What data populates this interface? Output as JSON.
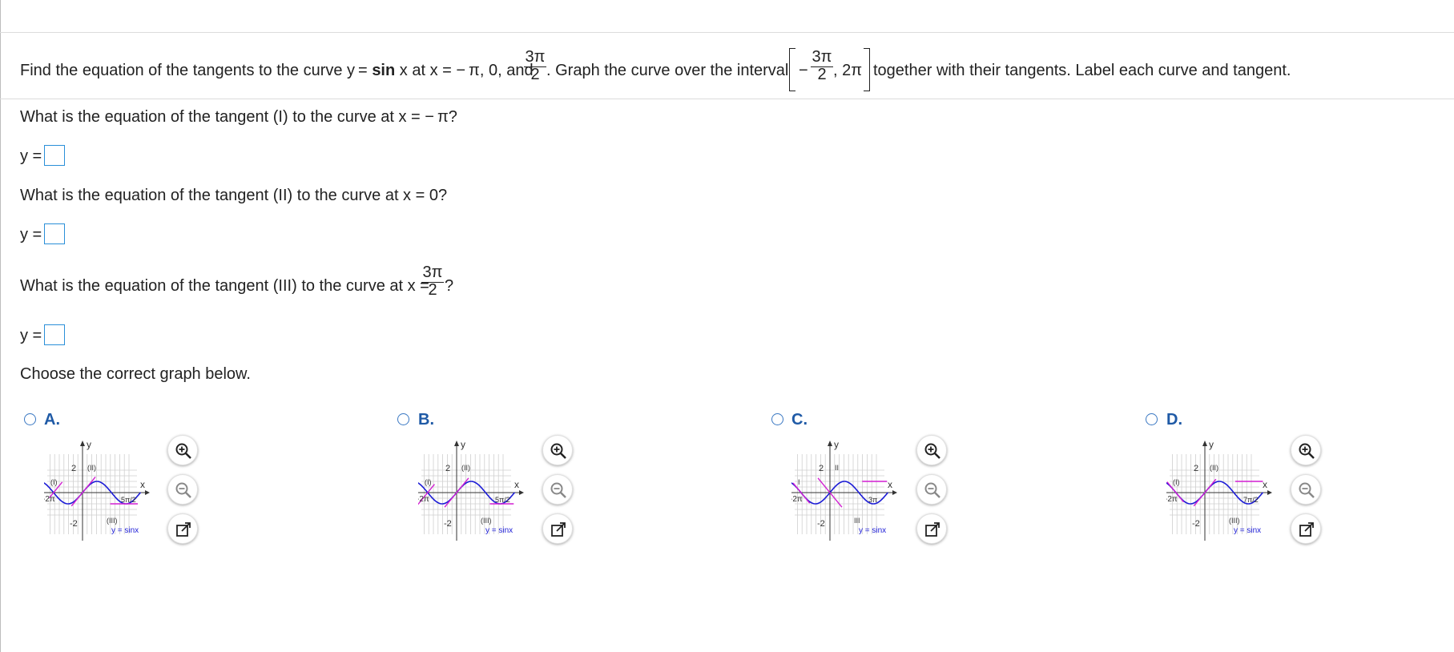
{
  "question": {
    "part1": "Find the equation of the tangents to the curve y =",
    "fn": "sin",
    "part2": "x at x = − π, 0, and",
    "frac_num": "3π",
    "frac_den": "2",
    "part3": ". Graph the curve over the interval",
    "interval_minus": "−",
    "interval_num": "3π",
    "interval_den": "2",
    "interval_end": ", 2π",
    "part4": "together with their tangents. Label each curve and tangent."
  },
  "q1": {
    "text": "What is the equation of the tangent (I) to the curve at x = − π?",
    "answer_label": "y ="
  },
  "q2": {
    "text": "What is the equation of the tangent (II) to the curve at x = 0?",
    "answer_label": "y ="
  },
  "q3": {
    "text": "What is the equation of the tangent (III) to the curve at x =",
    "frac_num": "3π",
    "frac_den": "2",
    "suffix": "?",
    "answer_label": "y ="
  },
  "choose_text": "Choose the correct graph below.",
  "options": [
    {
      "label": "A.",
      "tangent_labels": [
        "(I)",
        "(II)",
        "(III)"
      ],
      "tick_label": "5π/2",
      "curve_label": "y = sinx"
    },
    {
      "label": "B.",
      "tangent_labels": [
        "(I)",
        "(II)",
        "(III)"
      ],
      "tick_label": "5π/2",
      "curve_label": "y = sinx"
    },
    {
      "label": "C.",
      "tangent_labels": [
        "I",
        "II",
        "III"
      ],
      "tick_label": "3π",
      "curve_label": "y = sinx"
    },
    {
      "label": "D.",
      "tangent_labels": [
        "(I)",
        "(II)",
        "(III)"
      ],
      "tick_label": "7π/2",
      "curve_label": "y = sinx"
    }
  ],
  "graph_axis": {
    "y_label": "y",
    "x_label": "x",
    "y_top": "2",
    "y_bottom": "-2",
    "x_left": "-2π"
  },
  "colors": {
    "curve": "#1c1cd6",
    "tangent": "#d21fd2",
    "accent": "#1f5aa6",
    "box": "#2a8fd8"
  },
  "icons": {
    "zoom_in": "zoom-in-icon",
    "zoom_out": "zoom-out-icon",
    "open": "external-link-icon"
  }
}
